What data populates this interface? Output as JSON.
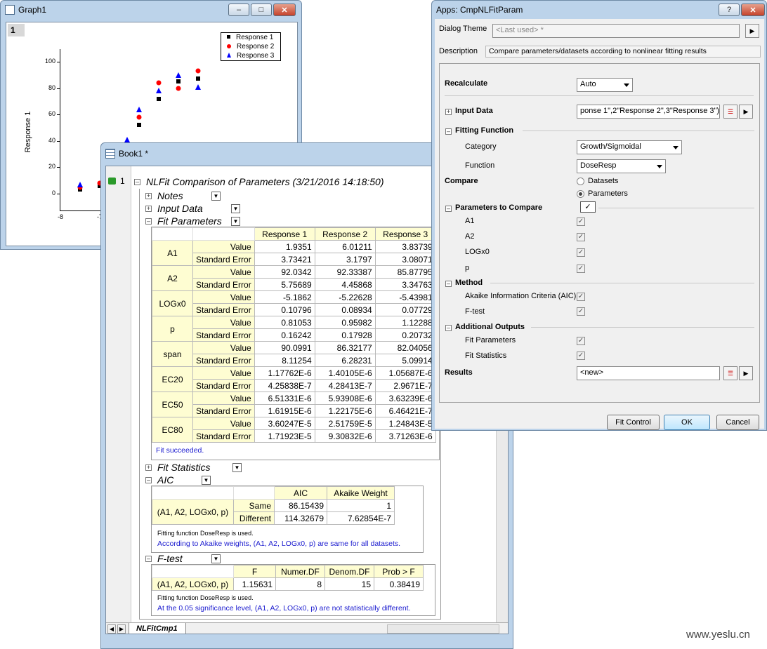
{
  "graph": {
    "title": "Graph1",
    "layer": "1",
    "ylabel": "Response 1",
    "yticks": [
      "100",
      "80",
      "60",
      "40",
      "20",
      "0"
    ],
    "xticks": [
      "-8",
      "-7"
    ],
    "legend": [
      "Response 1",
      "Response 2",
      "Response 3"
    ],
    "chart_data": {
      "type": "scatter",
      "ylabel": "Response 1",
      "ylim": [
        -10,
        110
      ],
      "legend_position": "top-right",
      "series": [
        {
          "name": "Response 1",
          "marker": "square",
          "color": "#000000",
          "points": [
            [
              -7.5,
              3
            ],
            [
              -7,
              6
            ],
            [
              -6,
              52
            ],
            [
              -5.5,
              72
            ],
            [
              -5,
              85
            ],
            [
              -4.5,
              87
            ]
          ]
        },
        {
          "name": "Response 2",
          "marker": "circle",
          "color": "#ff0000",
          "points": [
            [
              -7.5,
              5
            ],
            [
              -7,
              8
            ],
            [
              -6,
              58
            ],
            [
              -5.5,
              84
            ],
            [
              -5,
              80
            ],
            [
              -4.5,
              93
            ]
          ]
        },
        {
          "name": "Response 3",
          "marker": "triangle",
          "color": "#0000ff",
          "points": [
            [
              -7.5,
              7
            ],
            [
              -6.3,
              41
            ],
            [
              -6,
              64
            ],
            [
              -5.5,
              78
            ],
            [
              -5,
              90
            ],
            [
              -4.5,
              81
            ]
          ]
        }
      ]
    }
  },
  "book": {
    "title": "Book1 *",
    "row_num": "1",
    "report_title": "NLFit Comparison of Parameters (3/21/2016 14:18:50)",
    "sections": {
      "notes": "Notes",
      "input": "Input Data",
      "fitparams": "Fit Parameters",
      "fitstats": "Fit Statistics",
      "aic": "AIC",
      "ftest": "F-test"
    },
    "fp_headers": [
      "Response 1",
      "Response 2",
      "Response 3"
    ],
    "fp_rows": [
      {
        "param": "A1",
        "value": [
          "1.9351",
          "6.01211",
          "3.83739"
        ],
        "se": [
          "3.73421",
          "3.1797",
          "3.08071"
        ]
      },
      {
        "param": "A2",
        "value": [
          "92.0342",
          "92.33387",
          "85.87795"
        ],
        "se": [
          "5.75689",
          "4.45868",
          "3.34763"
        ]
      },
      {
        "param": "LOGx0",
        "value": [
          "-5.1862",
          "-5.22628",
          "-5.43981"
        ],
        "se": [
          "0.10796",
          "0.08934",
          "0.07729"
        ]
      },
      {
        "param": "p",
        "value": [
          "0.81053",
          "0.95982",
          "1.12288"
        ],
        "se": [
          "0.16242",
          "0.17928",
          "0.20732"
        ]
      },
      {
        "param": "span",
        "value": [
          "90.0991",
          "86.32177",
          "82.04056"
        ],
        "se": [
          "8.11254",
          "6.28231",
          "5.09914"
        ]
      },
      {
        "param": "EC20",
        "value": [
          "1.17762E-6",
          "1.40105E-6",
          "1.05687E-6"
        ],
        "se": [
          "4.25838E-7",
          "4.28413E-7",
          "2.9671E-7"
        ]
      },
      {
        "param": "EC50",
        "value": [
          "6.51331E-6",
          "5.93908E-6",
          "3.63239E-6"
        ],
        "se": [
          "1.61915E-6",
          "1.22175E-6",
          "6.46421E-7"
        ]
      },
      {
        "param": "EC80",
        "value": [
          "3.60247E-5",
          "2.51759E-5",
          "1.24843E-5"
        ],
        "se": [
          "1.71923E-5",
          "9.30832E-6",
          "3.71263E-6"
        ]
      }
    ],
    "value_label": "Value",
    "se_label": "Standard Error",
    "fit_succeeded": "Fit succeeded.",
    "aic_table": {
      "headers": [
        "AIC",
        "Akaike Weight"
      ],
      "group": "(A1, A2, LOGx0, p)",
      "rows": [
        {
          "label": "Same",
          "aic": "86.15439",
          "w": "1"
        },
        {
          "label": "Different",
          "aic": "114.32679",
          "w": "7.62854E-7"
        }
      ]
    },
    "aic_note1": "Fitting function DoseResp is used.",
    "aic_note2": "According to Akaike weights, (A1, A2, LOGx0, p) are same for all datasets.",
    "ftest_table": {
      "headers": [
        "F",
        "Numer.DF",
        "Denom.DF",
        "Prob > F"
      ],
      "row": [
        "(A1, A2, LOGx0, p)",
        "1.15631",
        "8",
        "15",
        "0.38419"
      ]
    },
    "ftest_note1": "Fitting function DoseResp is used.",
    "ftest_note2": "At the 0.05 significance level, (A1, A2, LOGx0, p) are not statistically different.",
    "sheet_tab": "NLFitCmp1"
  },
  "dialog": {
    "title": "Apps: CmpNLFitParam",
    "theme_label": "Dialog Theme",
    "theme_value": "<Last used> *",
    "desc_label": "Description",
    "desc_value": "Compare parameters/datasets according to nonlinear fitting results",
    "recalc_label": "Recalculate",
    "recalc_value": "Auto",
    "input_label": "Input Data",
    "input_value": "ponse 1\",2\"Response 2\",3\"Response 3\")",
    "fitfunc_label": "Fitting Function",
    "category_label": "Category",
    "category_value": "Growth/Sigmoidal",
    "function_label": "Function",
    "function_value": "DoseResp",
    "compare_label": "Compare",
    "opt_datasets": "Datasets",
    "opt_parameters": "Parameters",
    "p2c_label": "Parameters to Compare",
    "params": [
      "A1",
      "A2",
      "LOGx0",
      "p"
    ],
    "method_label": "Method",
    "aic_label": "Akaike Information Criteria (AIC)",
    "ftest_label": "F-test",
    "addout_label": "Additional Outputs",
    "out_fitparams": "Fit Parameters",
    "out_fitstats": "Fit Statistics",
    "results_label": "Results",
    "results_value": "<new>",
    "btn_fitcontrol": "Fit Control",
    "btn_ok": "OK",
    "btn_cancel": "Cancel",
    "help": "?"
  },
  "watermark": "www.yeslu.cn"
}
